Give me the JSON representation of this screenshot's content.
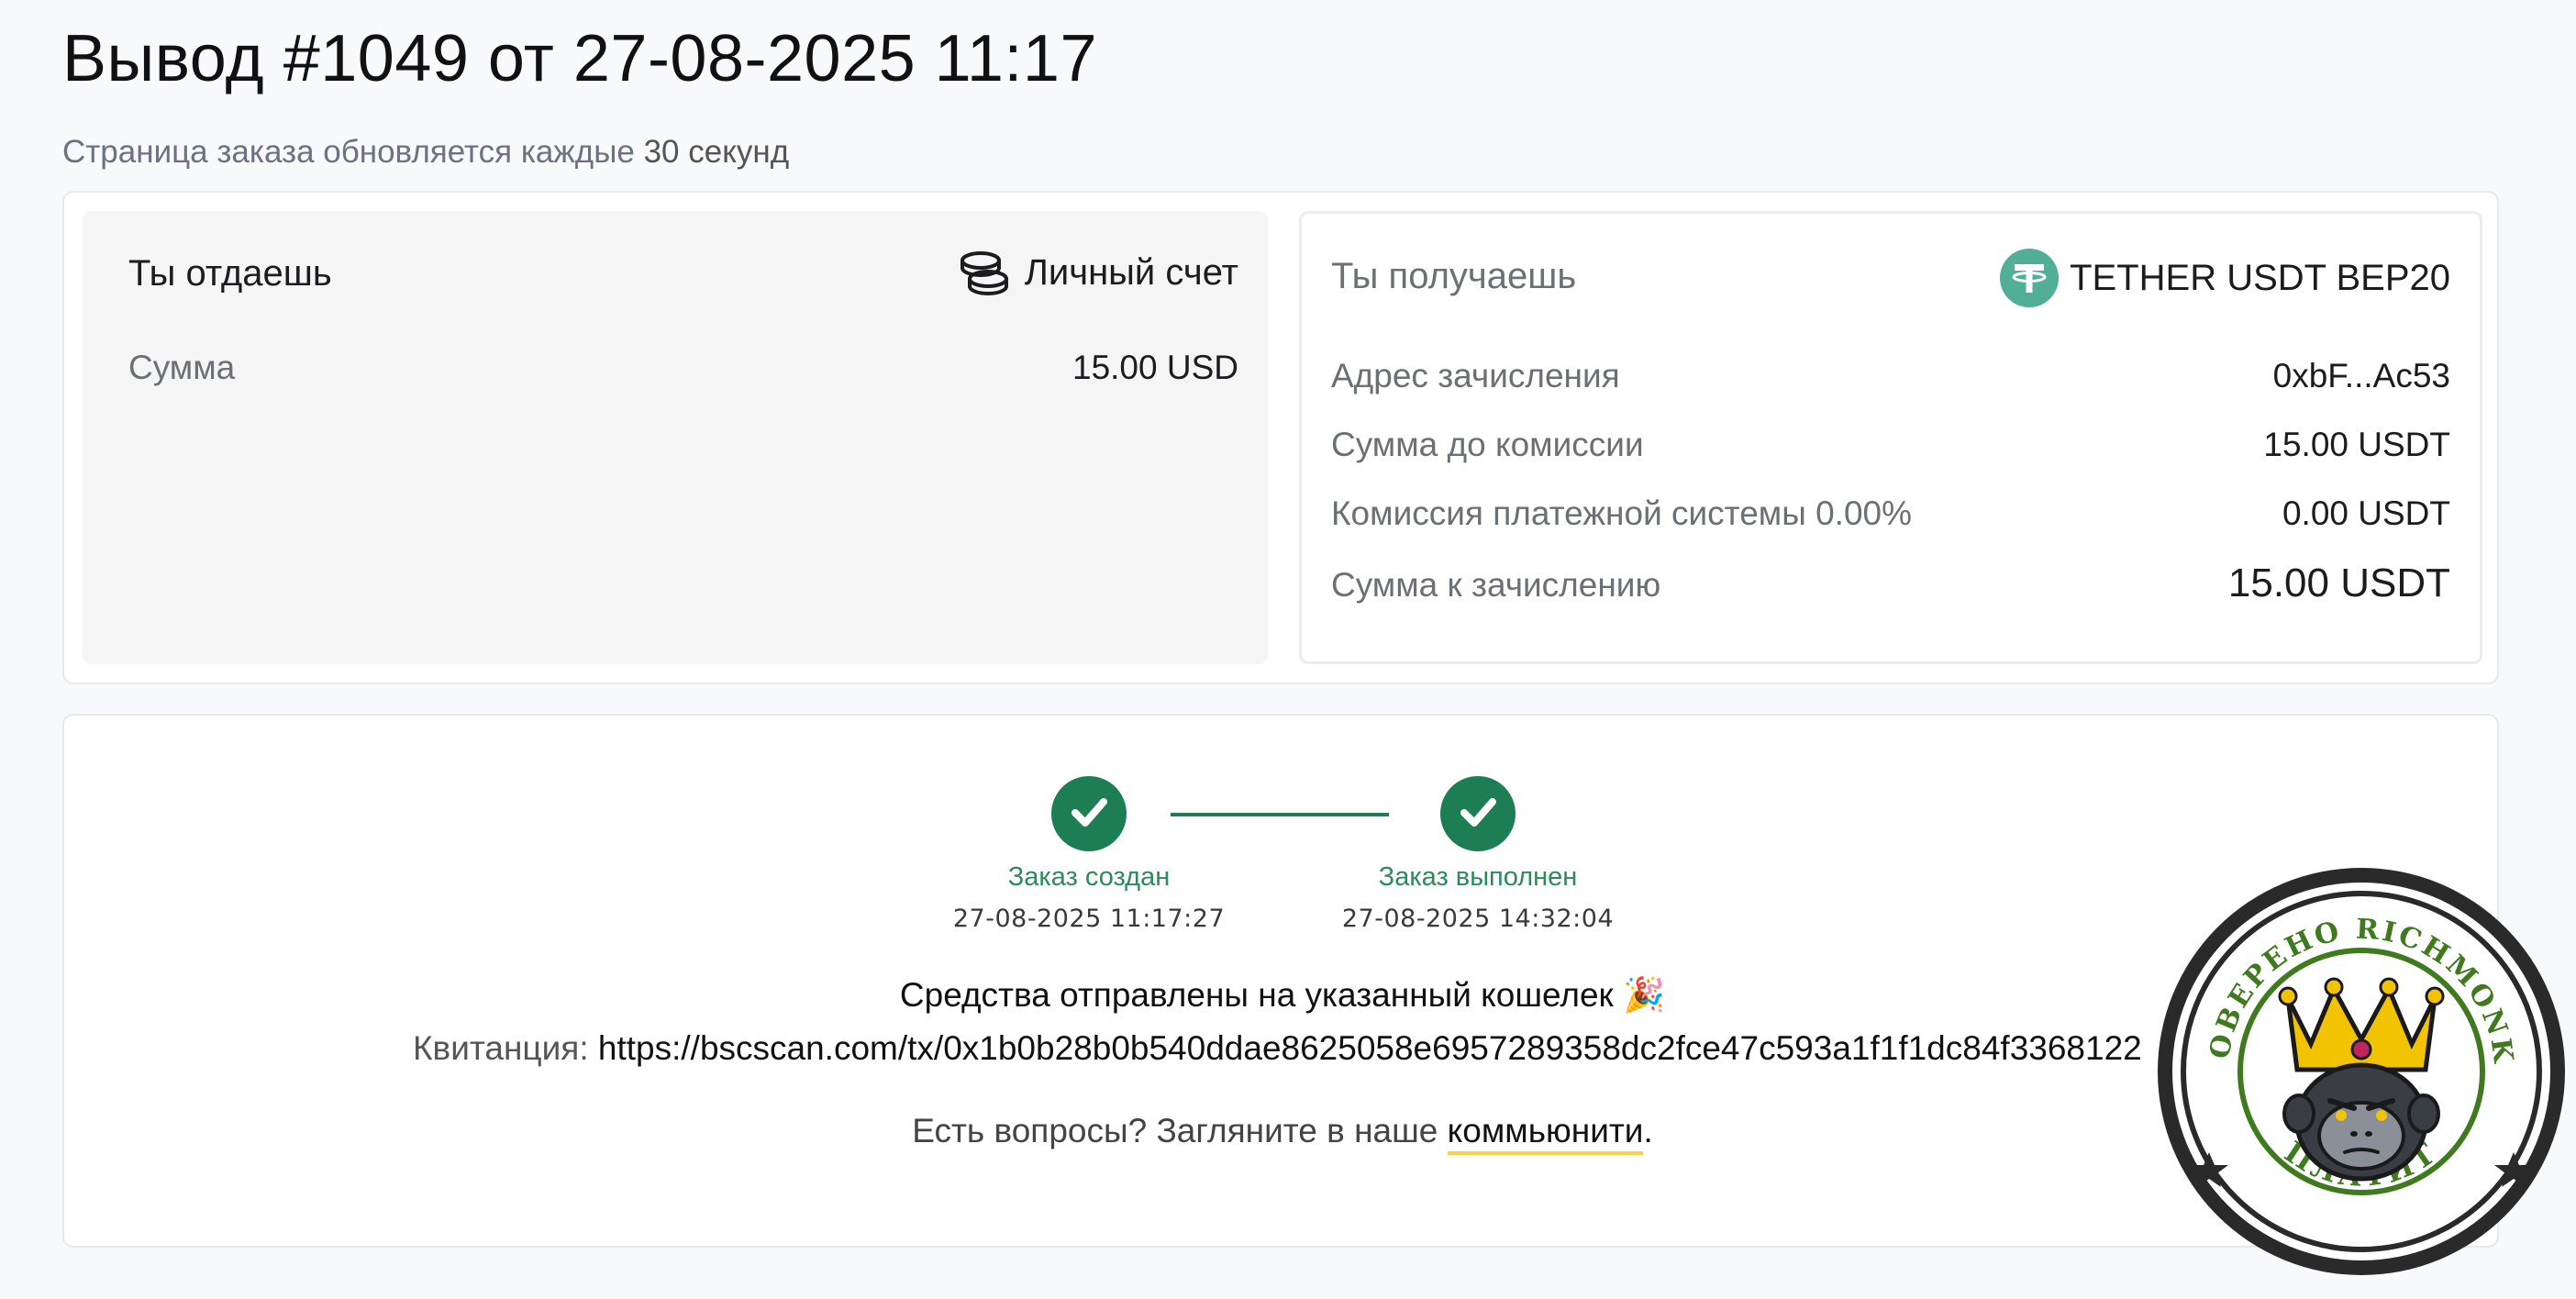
{
  "header": {
    "title": "Вывод #1049 от 27-08-2025 11:17",
    "subtitle_prefix": "Страница заказа обновляется каждые",
    "subtitle_strong": "30 секунд"
  },
  "give": {
    "title": "Ты отдаешь",
    "method_label": "Личный счет",
    "method_icon": "coins-icon",
    "rows": [
      {
        "label": "Сумма",
        "value": "15.00 USD"
      }
    ]
  },
  "receive": {
    "title": "Ты получаешь",
    "method_label": "TETHER USDT BEP20",
    "method_icon": "tether-icon",
    "rows": [
      {
        "label": "Адрес зачисления",
        "value": "0xbF...Ac53"
      },
      {
        "label": "Сумма до комиссии",
        "value": "15.00 USDT"
      },
      {
        "label": "Комиссия платежной системы 0.00%",
        "value": "0.00 USDT"
      },
      {
        "label": "Сумма к зачислению",
        "value": "15.00 USDT"
      }
    ]
  },
  "progress": {
    "steps": [
      {
        "label": "Заказ создан",
        "date": "27-08-2025 11:17:27"
      },
      {
        "label": "Заказ выполнен",
        "date": "27-08-2025 14:32:04"
      }
    ]
  },
  "status": {
    "message": "Средства отправлены на указанный кошелек 🎉",
    "receipt_label": "Квитанция:",
    "receipt_url": "https://bscscan.com/tx/0x1b0b28b0b540ddae8625058e6957289358dc2fce47c593a1f1f1dc84f3368122",
    "questions_prefix": "Есть вопросы? Загляните в наше",
    "community_link": "коммьюнити",
    "questions_suffix": "."
  },
  "stamp": {
    "top_text": "ПРОВЕРЕНО RICHMONKEY",
    "bottom_text": "ПЛАТИТ"
  },
  "colors": {
    "success": "#1e7e53",
    "tether": "#50af95",
    "link_underline": "#f5d24b"
  }
}
